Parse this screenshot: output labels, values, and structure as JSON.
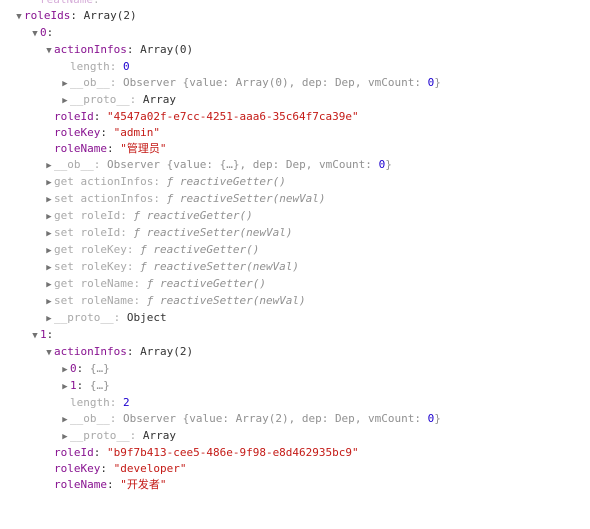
{
  "topFaded": {
    "key": "realName",
    "value": "\"\""
  },
  "rootKey": "roleIds",
  "rootPreview": "Array(2)",
  "items": [
    {
      "indexKey": "0",
      "actionInfos": {
        "key": "actionInfos",
        "preview": "Array(0)",
        "length": {
          "key": "length",
          "value": "0"
        },
        "ob": {
          "key": "__ob__",
          "prefix": "Observer {value: ",
          "arr": "Array(0)",
          "mid1": ", dep: ",
          "dep": "Dep",
          "mid2": ", vmCount: ",
          "vmcount": "0",
          "suffix": "}"
        },
        "proto": {
          "key": "__proto__",
          "value": "Array"
        }
      },
      "roleId": {
        "key": "roleId",
        "value": "\"4547a02f-e7cc-4251-aaa6-35c64f7ca39e\""
      },
      "roleKey": {
        "key": "roleKey",
        "value": "\"admin\""
      },
      "roleName": {
        "key": "roleName",
        "value": "\"管理员\""
      },
      "ob": {
        "key": "__ob__",
        "prefix": "Observer {value: ",
        "placeholder": "{…}",
        "mid1": ", dep: ",
        "dep": "Dep",
        "mid2": ", vmCount: ",
        "vmcount": "0",
        "suffix": "}"
      },
      "accessors": [
        {
          "gs": "get ",
          "name": "actionInfos",
          "fn": "ƒ reactiveGetter()"
        },
        {
          "gs": "set ",
          "name": "actionInfos",
          "fn": "ƒ reactiveSetter(newVal)"
        },
        {
          "gs": "get ",
          "name": "roleId",
          "fn": "ƒ reactiveGetter()"
        },
        {
          "gs": "set ",
          "name": "roleId",
          "fn": "ƒ reactiveSetter(newVal)"
        },
        {
          "gs": "get ",
          "name": "roleKey",
          "fn": "ƒ reactiveGetter()"
        },
        {
          "gs": "set ",
          "name": "roleKey",
          "fn": "ƒ reactiveSetter(newVal)"
        },
        {
          "gs": "get ",
          "name": "roleName",
          "fn": "ƒ reactiveGetter()"
        },
        {
          "gs": "set ",
          "name": "roleName",
          "fn": "ƒ reactiveSetter(newVal)"
        }
      ],
      "proto": {
        "key": "__proto__",
        "value": "Object"
      }
    },
    {
      "indexKey": "1",
      "actionInfos": {
        "key": "actionInfos",
        "preview": "Array(2)",
        "entries": [
          {
            "key": "0",
            "value": "{…}"
          },
          {
            "key": "1",
            "value": "{…}"
          }
        ],
        "length": {
          "key": "length",
          "value": "2"
        },
        "ob": {
          "key": "__ob__",
          "prefix": "Observer {value: ",
          "arr": "Array(2)",
          "mid1": ", dep: ",
          "dep": "Dep",
          "mid2": ", vmCount: ",
          "vmcount": "0",
          "suffix": "}"
        },
        "proto": {
          "key": "__proto__",
          "value": "Array"
        }
      },
      "roleId": {
        "key": "roleId",
        "value": "\"b9f7b413-cee5-486e-9f98-e8d462935bc9\""
      },
      "roleKey": {
        "key": "roleKey",
        "value": "\"developer\""
      },
      "roleName": {
        "key": "roleName",
        "value": "\"开发者\""
      }
    }
  ]
}
